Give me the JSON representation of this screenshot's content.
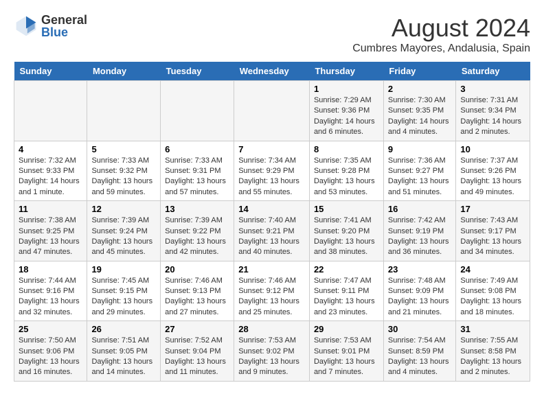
{
  "header": {
    "logo": {
      "general": "General",
      "blue": "Blue"
    },
    "title": "August 2024",
    "subtitle": "Cumbres Mayores, Andalusia, Spain"
  },
  "days_of_week": [
    "Sunday",
    "Monday",
    "Tuesday",
    "Wednesday",
    "Thursday",
    "Friday",
    "Saturday"
  ],
  "weeks": [
    {
      "days": [
        {
          "number": "",
          "info": ""
        },
        {
          "number": "",
          "info": ""
        },
        {
          "number": "",
          "info": ""
        },
        {
          "number": "",
          "info": ""
        },
        {
          "number": "1",
          "info": "Sunrise: 7:29 AM\nSunset: 9:36 PM\nDaylight: 14 hours and 6 minutes."
        },
        {
          "number": "2",
          "info": "Sunrise: 7:30 AM\nSunset: 9:35 PM\nDaylight: 14 hours and 4 minutes."
        },
        {
          "number": "3",
          "info": "Sunrise: 7:31 AM\nSunset: 9:34 PM\nDaylight: 14 hours and 2 minutes."
        }
      ]
    },
    {
      "days": [
        {
          "number": "4",
          "info": "Sunrise: 7:32 AM\nSunset: 9:33 PM\nDaylight: 14 hours and 1 minute."
        },
        {
          "number": "5",
          "info": "Sunrise: 7:33 AM\nSunset: 9:32 PM\nDaylight: 13 hours and 59 minutes."
        },
        {
          "number": "6",
          "info": "Sunrise: 7:33 AM\nSunset: 9:31 PM\nDaylight: 13 hours and 57 minutes."
        },
        {
          "number": "7",
          "info": "Sunrise: 7:34 AM\nSunset: 9:29 PM\nDaylight: 13 hours and 55 minutes."
        },
        {
          "number": "8",
          "info": "Sunrise: 7:35 AM\nSunset: 9:28 PM\nDaylight: 13 hours and 53 minutes."
        },
        {
          "number": "9",
          "info": "Sunrise: 7:36 AM\nSunset: 9:27 PM\nDaylight: 13 hours and 51 minutes."
        },
        {
          "number": "10",
          "info": "Sunrise: 7:37 AM\nSunset: 9:26 PM\nDaylight: 13 hours and 49 minutes."
        }
      ]
    },
    {
      "days": [
        {
          "number": "11",
          "info": "Sunrise: 7:38 AM\nSunset: 9:25 PM\nDaylight: 13 hours and 47 minutes."
        },
        {
          "number": "12",
          "info": "Sunrise: 7:39 AM\nSunset: 9:24 PM\nDaylight: 13 hours and 45 minutes."
        },
        {
          "number": "13",
          "info": "Sunrise: 7:39 AM\nSunset: 9:22 PM\nDaylight: 13 hours and 42 minutes."
        },
        {
          "number": "14",
          "info": "Sunrise: 7:40 AM\nSunset: 9:21 PM\nDaylight: 13 hours and 40 minutes."
        },
        {
          "number": "15",
          "info": "Sunrise: 7:41 AM\nSunset: 9:20 PM\nDaylight: 13 hours and 38 minutes."
        },
        {
          "number": "16",
          "info": "Sunrise: 7:42 AM\nSunset: 9:19 PM\nDaylight: 13 hours and 36 minutes."
        },
        {
          "number": "17",
          "info": "Sunrise: 7:43 AM\nSunset: 9:17 PM\nDaylight: 13 hours and 34 minutes."
        }
      ]
    },
    {
      "days": [
        {
          "number": "18",
          "info": "Sunrise: 7:44 AM\nSunset: 9:16 PM\nDaylight: 13 hours and 32 minutes."
        },
        {
          "number": "19",
          "info": "Sunrise: 7:45 AM\nSunset: 9:15 PM\nDaylight: 13 hours and 29 minutes."
        },
        {
          "number": "20",
          "info": "Sunrise: 7:46 AM\nSunset: 9:13 PM\nDaylight: 13 hours and 27 minutes."
        },
        {
          "number": "21",
          "info": "Sunrise: 7:46 AM\nSunset: 9:12 PM\nDaylight: 13 hours and 25 minutes."
        },
        {
          "number": "22",
          "info": "Sunrise: 7:47 AM\nSunset: 9:11 PM\nDaylight: 13 hours and 23 minutes."
        },
        {
          "number": "23",
          "info": "Sunrise: 7:48 AM\nSunset: 9:09 PM\nDaylight: 13 hours and 21 minutes."
        },
        {
          "number": "24",
          "info": "Sunrise: 7:49 AM\nSunset: 9:08 PM\nDaylight: 13 hours and 18 minutes."
        }
      ]
    },
    {
      "days": [
        {
          "number": "25",
          "info": "Sunrise: 7:50 AM\nSunset: 9:06 PM\nDaylight: 13 hours and 16 minutes."
        },
        {
          "number": "26",
          "info": "Sunrise: 7:51 AM\nSunset: 9:05 PM\nDaylight: 13 hours and 14 minutes."
        },
        {
          "number": "27",
          "info": "Sunrise: 7:52 AM\nSunset: 9:04 PM\nDaylight: 13 hours and 11 minutes."
        },
        {
          "number": "28",
          "info": "Sunrise: 7:53 AM\nSunset: 9:02 PM\nDaylight: 13 hours and 9 minutes."
        },
        {
          "number": "29",
          "info": "Sunrise: 7:53 AM\nSunset: 9:01 PM\nDaylight: 13 hours and 7 minutes."
        },
        {
          "number": "30",
          "info": "Sunrise: 7:54 AM\nSunset: 8:59 PM\nDaylight: 13 hours and 4 minutes."
        },
        {
          "number": "31",
          "info": "Sunrise: 7:55 AM\nSunset: 8:58 PM\nDaylight: 13 hours and 2 minutes."
        }
      ]
    }
  ]
}
